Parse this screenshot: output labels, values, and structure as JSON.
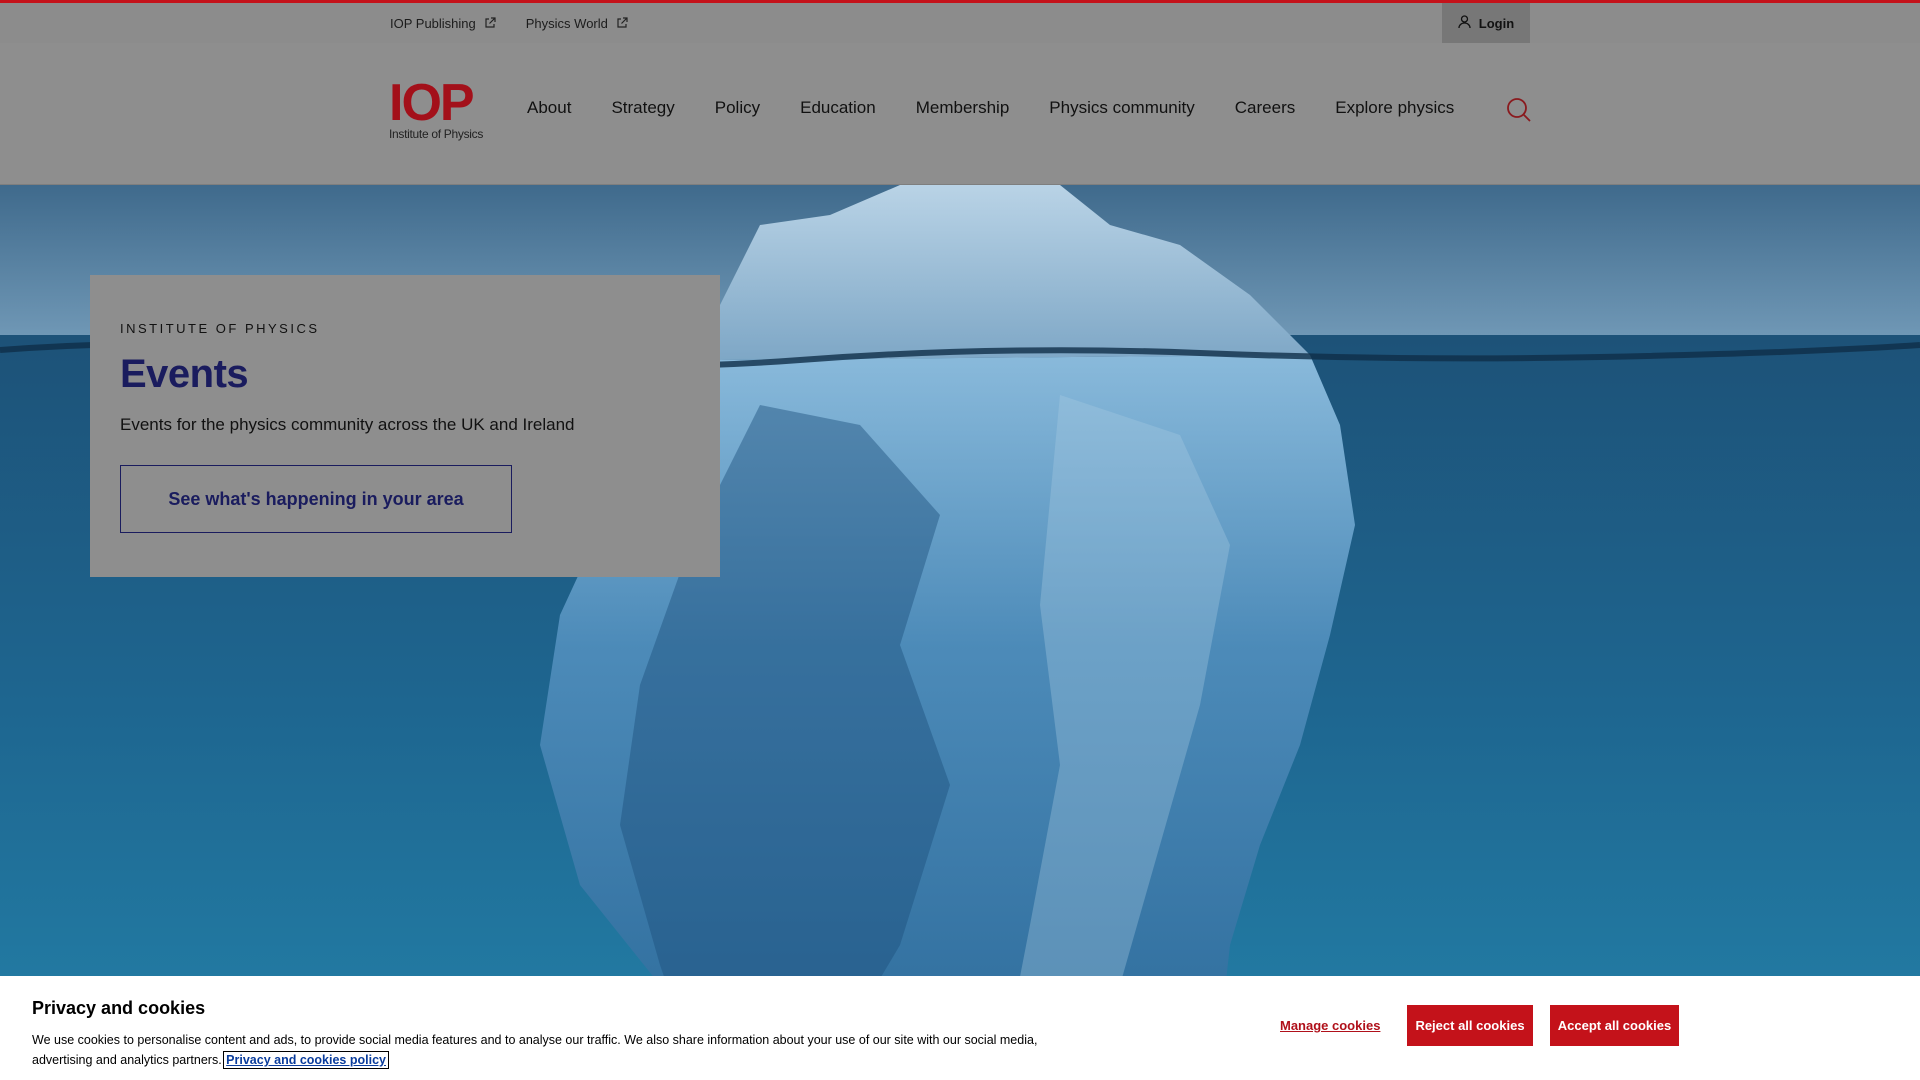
{
  "utility": {
    "links": [
      {
        "label": "IOP Publishing",
        "icon": "external-link-icon"
      },
      {
        "label": "Physics World",
        "icon": "external-link-icon"
      }
    ],
    "login_label": "Login"
  },
  "header": {
    "logo_mark": "IOP",
    "logo_sub": "Institute of Physics",
    "nav": [
      "About",
      "Strategy",
      "Policy",
      "Education",
      "Membership",
      "Physics community",
      "Careers",
      "Explore physics"
    ],
    "search_icon": "search-icon"
  },
  "hero": {
    "eyebrow": "INSTITUTE OF PHYSICS",
    "title": "Events",
    "description": "Events for the physics community across the UK and Ireland",
    "cta_label": "See what's happening in your area"
  },
  "cookies": {
    "title": "Privacy and cookies",
    "text": "We use cookies to personalise content and ads, to provide social media features and to analyse our traffic. We also share information about your use of our site with our social media, advertising and analytics partners.",
    "policy_link": "Privacy and cookies policy",
    "manage_label": "Manage cookies",
    "reject_label": "Reject all cookies",
    "accept_label": "Accept all cookies"
  },
  "colors": {
    "brand_red": "#c4121a",
    "brand_navy": "#1a1c5e"
  }
}
